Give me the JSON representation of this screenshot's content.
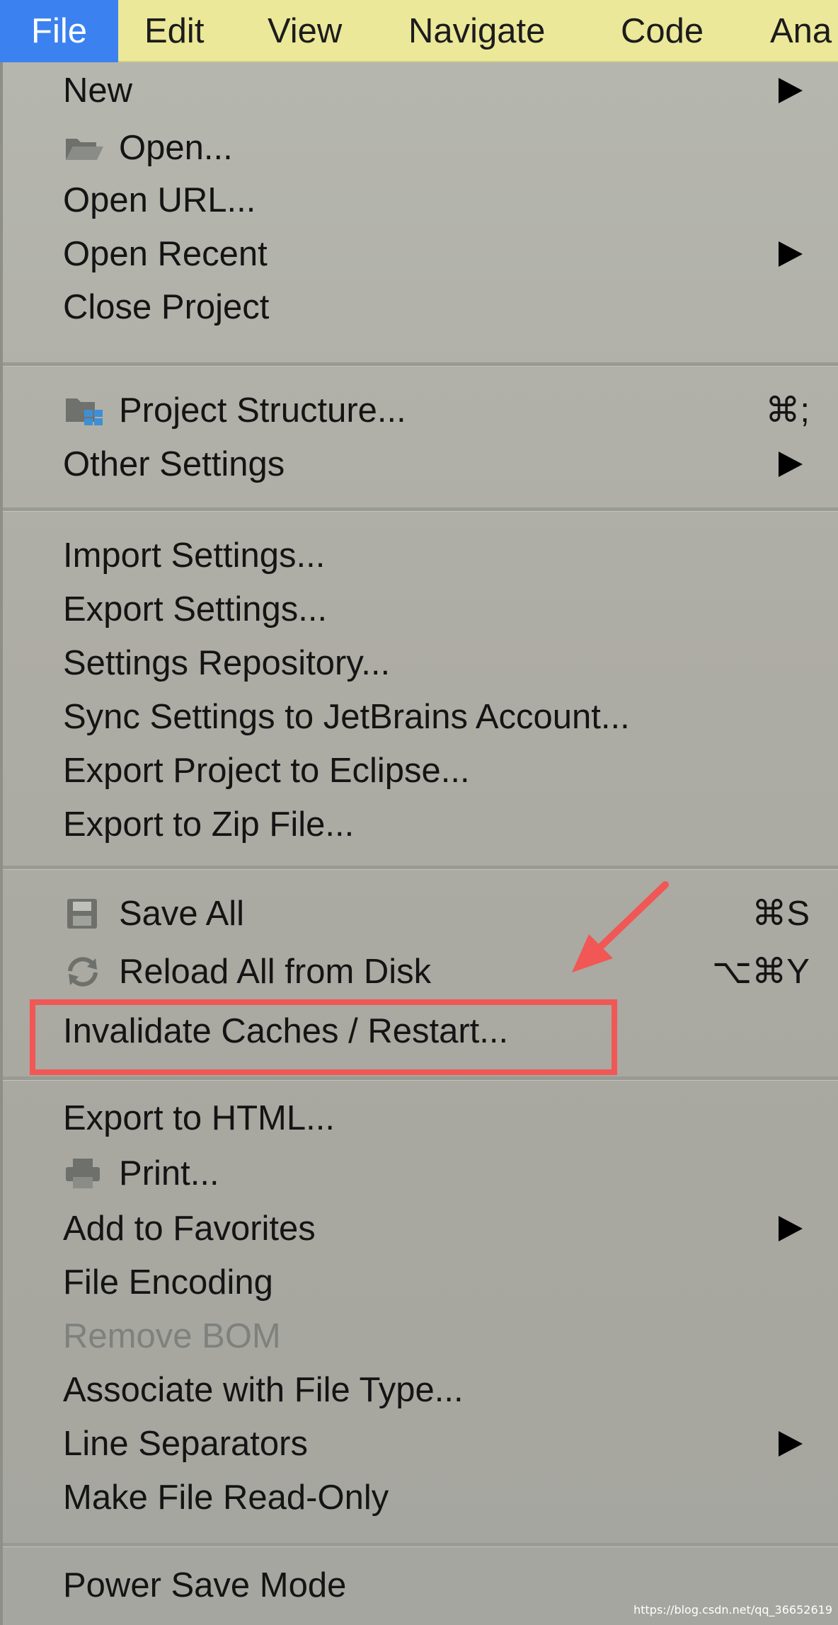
{
  "menubar": {
    "items": [
      {
        "label": "File",
        "active": true
      },
      {
        "label": "Edit"
      },
      {
        "label": "View"
      },
      {
        "label": "Navigate"
      },
      {
        "label": "Code"
      },
      {
        "label": "Ana"
      }
    ]
  },
  "menu": {
    "items": [
      {
        "label": "New",
        "submenu": true
      },
      {
        "label": "Open...",
        "icon": "folder-icon"
      },
      {
        "label": "Open URL..."
      },
      {
        "label": "Open Recent",
        "submenu": true
      },
      {
        "label": "Close Project"
      },
      {
        "label": "Project Structure...",
        "icon": "project-structure-icon",
        "shortcut": "⌘;"
      },
      {
        "label": "Other Settings",
        "submenu": true
      },
      {
        "label": "Import Settings..."
      },
      {
        "label": "Export Settings..."
      },
      {
        "label": "Settings Repository..."
      },
      {
        "label": "Sync Settings to JetBrains Account..."
      },
      {
        "label": "Export Project to Eclipse..."
      },
      {
        "label": "Export to Zip File..."
      },
      {
        "label": "Save All",
        "icon": "save-icon",
        "shortcut": "⌘S"
      },
      {
        "label": "Reload All from Disk",
        "icon": "reload-icon",
        "shortcut": "⌥⌘Y"
      },
      {
        "label": "Invalidate Caches / Restart...",
        "highlighted": true
      },
      {
        "label": "Export to HTML..."
      },
      {
        "label": "Print...",
        "icon": "printer-icon"
      },
      {
        "label": "Add to Favorites",
        "submenu": true
      },
      {
        "label": "File Encoding"
      },
      {
        "label": "Remove BOM",
        "disabled": true
      },
      {
        "label": "Associate with File Type..."
      },
      {
        "label": "Line Separators",
        "submenu": true
      },
      {
        "label": "Make File Read-Only"
      },
      {
        "label": "Power Save Mode"
      }
    ]
  },
  "annotation": {
    "color": "#f05755"
  },
  "watermark": "https://blog.csdn.net/qq_36652619"
}
